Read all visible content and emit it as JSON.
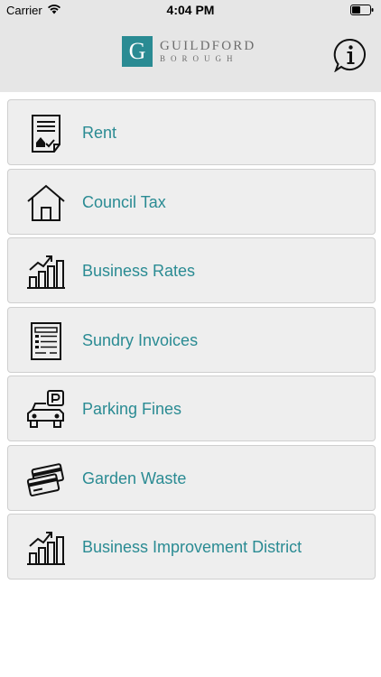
{
  "status_bar": {
    "carrier": "Carrier",
    "time": "4:04 PM"
  },
  "header": {
    "logo_letter": "G",
    "logo_line1": "GUILDFORD",
    "logo_line2": "BOROUGH",
    "info_icon": "info-icon"
  },
  "menu": {
    "items": [
      {
        "label": "Rent",
        "icon": "rent-document-icon"
      },
      {
        "label": "Council Tax",
        "icon": "house-icon"
      },
      {
        "label": "Business Rates",
        "icon": "bar-chart-icon"
      },
      {
        "label": "Sundry Invoices",
        "icon": "invoice-icon"
      },
      {
        "label": "Parking Fines",
        "icon": "parking-car-icon"
      },
      {
        "label": "Garden Waste",
        "icon": "cards-icon"
      },
      {
        "label": "Business Improvement District",
        "icon": "bar-chart-icon"
      }
    ]
  },
  "colors": {
    "accent": "#2a8b93",
    "header_bg": "#e6e6e6",
    "item_bg": "#eeeeee"
  }
}
